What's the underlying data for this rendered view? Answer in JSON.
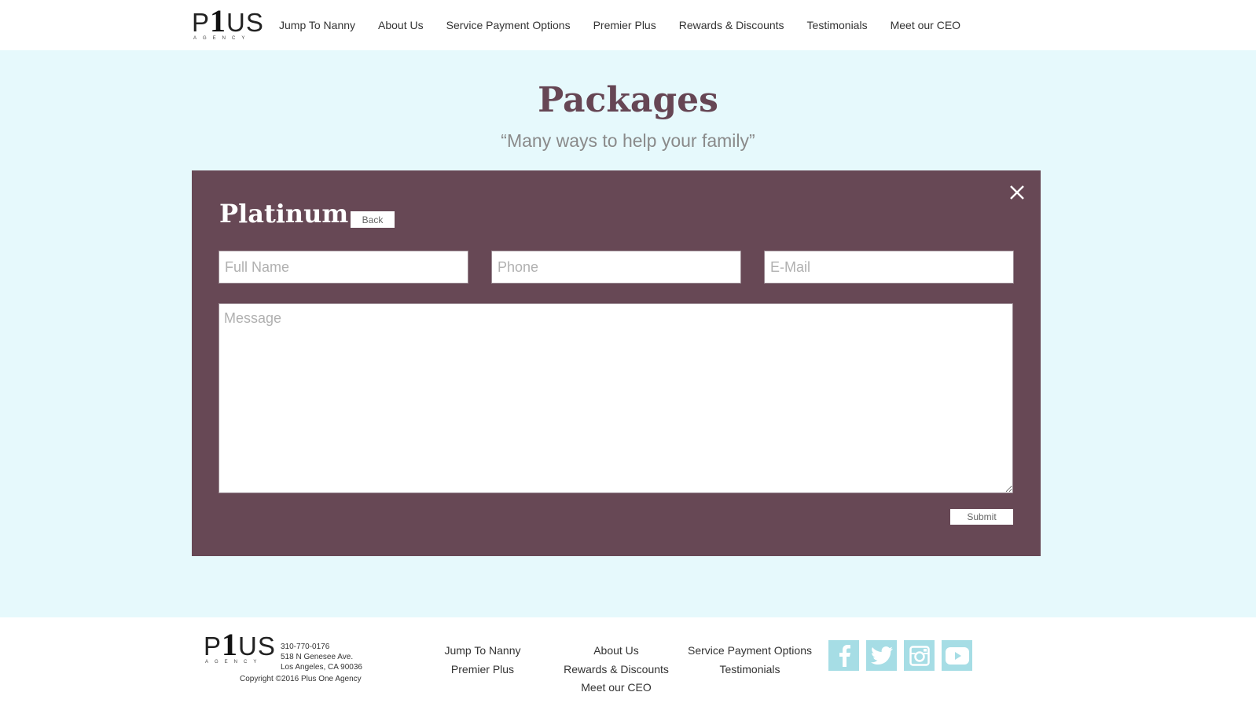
{
  "brand": {
    "logo_main": "P",
    "logo_one": "1",
    "logo_rest": "US",
    "logo_sub": "AGENCY"
  },
  "nav": {
    "items": [
      "Jump To Nanny",
      "About Us",
      "Service Payment Options",
      "Premier Plus",
      "Rewards & Discounts",
      "Testimonials",
      "Meet our CEO"
    ]
  },
  "main": {
    "title": "Packages",
    "subtitle": "“Many ways to help your family”"
  },
  "modal": {
    "title": "Platinum",
    "back_label": "Back",
    "full_name_placeholder": "Full Name",
    "phone_placeholder": "Phone",
    "email_placeholder": "E-Mail",
    "message_placeholder": "Message",
    "submit_label": "Submit",
    "close_icon": "close-icon"
  },
  "footer": {
    "phone": "310-770-0176",
    "address1": "518 N Genesee Ave.",
    "address2": "Los Angeles, CA 90036",
    "copyright": "Copyright ©2016 Plus One Agency",
    "col1": [
      "Jump To Nanny",
      "Premier Plus"
    ],
    "col2": [
      "About Us",
      "Rewards & Discounts",
      "Meet our CEO"
    ],
    "col3": [
      "Service Payment Options",
      "Testimonials"
    ],
    "social": [
      "facebook-icon",
      "twitter-icon",
      "instagram-icon",
      "youtube-icon"
    ]
  },
  "colors": {
    "background": "#e6f9fc",
    "modal": "#674855",
    "title": "#664654",
    "social": "#a6dde5"
  }
}
